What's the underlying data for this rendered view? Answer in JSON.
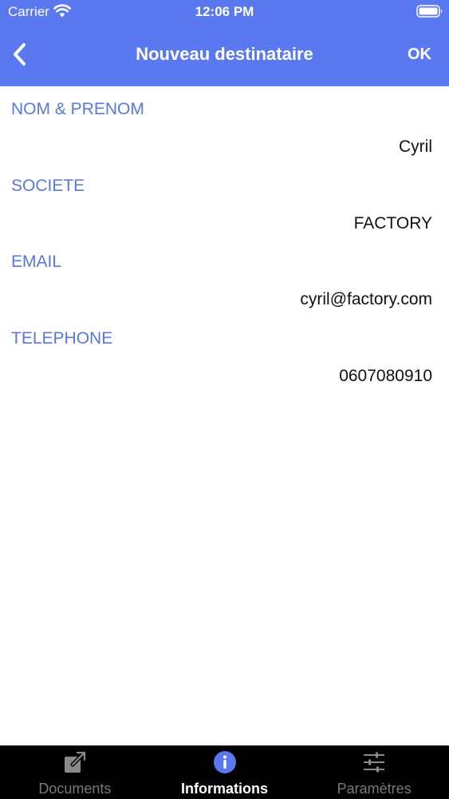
{
  "status_bar": {
    "carrier": "Carrier",
    "time": "12:06 PM"
  },
  "nav": {
    "title": "Nouveau destinataire",
    "ok_label": "OK"
  },
  "form": {
    "fields": [
      {
        "label": "NOM & PRENOM",
        "value": "Cyril"
      },
      {
        "label": "SOCIETE",
        "value": "FACTORY"
      },
      {
        "label": "EMAIL",
        "value": "cyril@factory.com"
      },
      {
        "label": "TELEPHONE",
        "value": "0607080910"
      }
    ]
  },
  "tab_bar": {
    "tabs": [
      {
        "label": "Documents",
        "icon": "share-icon",
        "active": false
      },
      {
        "label": "Informations",
        "icon": "info-icon",
        "active": true
      },
      {
        "label": "Paramètres",
        "icon": "sliders-icon",
        "active": false
      }
    ]
  },
  "colors": {
    "accent": "#5a78f0",
    "label": "#5a78d8",
    "tab_bar_bg": "#000000",
    "tab_inactive": "#7a7a7a"
  }
}
